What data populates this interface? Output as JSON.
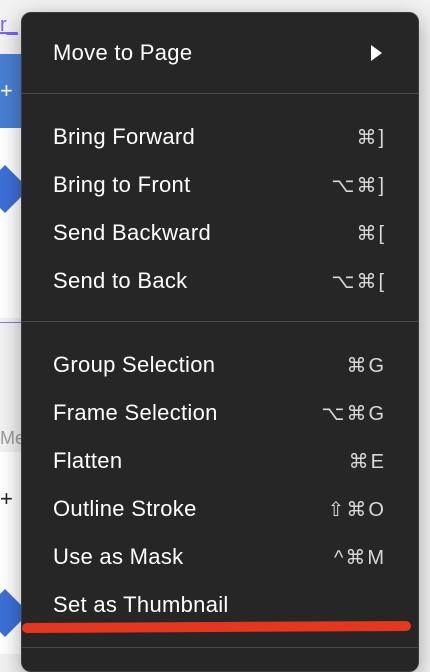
{
  "background": {
    "link_fragment": "r_",
    "plus_symbol": "+",
    "meta_fragment": "Me"
  },
  "menu": {
    "groups": [
      {
        "items": [
          {
            "label": "Move to Page",
            "shortcut": "",
            "has_submenu": true
          }
        ]
      },
      {
        "items": [
          {
            "label": "Bring Forward",
            "shortcut": "⌘]"
          },
          {
            "label": "Bring to Front",
            "shortcut": "⌥⌘]"
          },
          {
            "label": "Send Backward",
            "shortcut": "⌘["
          },
          {
            "label": "Send to Back",
            "shortcut": "⌥⌘["
          }
        ]
      },
      {
        "items": [
          {
            "label": "Group Selection",
            "shortcut": "⌘G"
          },
          {
            "label": "Frame Selection",
            "shortcut": "⌥⌘G"
          },
          {
            "label": "Flatten",
            "shortcut": "⌘E"
          },
          {
            "label": "Outline Stroke",
            "shortcut": "⇧⌘O"
          },
          {
            "label": "Use as Mask",
            "shortcut": "^⌘M"
          },
          {
            "label": "Set as Thumbnail",
            "shortcut": ""
          }
        ]
      }
    ]
  },
  "annotation": {
    "color": "#e5361f"
  }
}
